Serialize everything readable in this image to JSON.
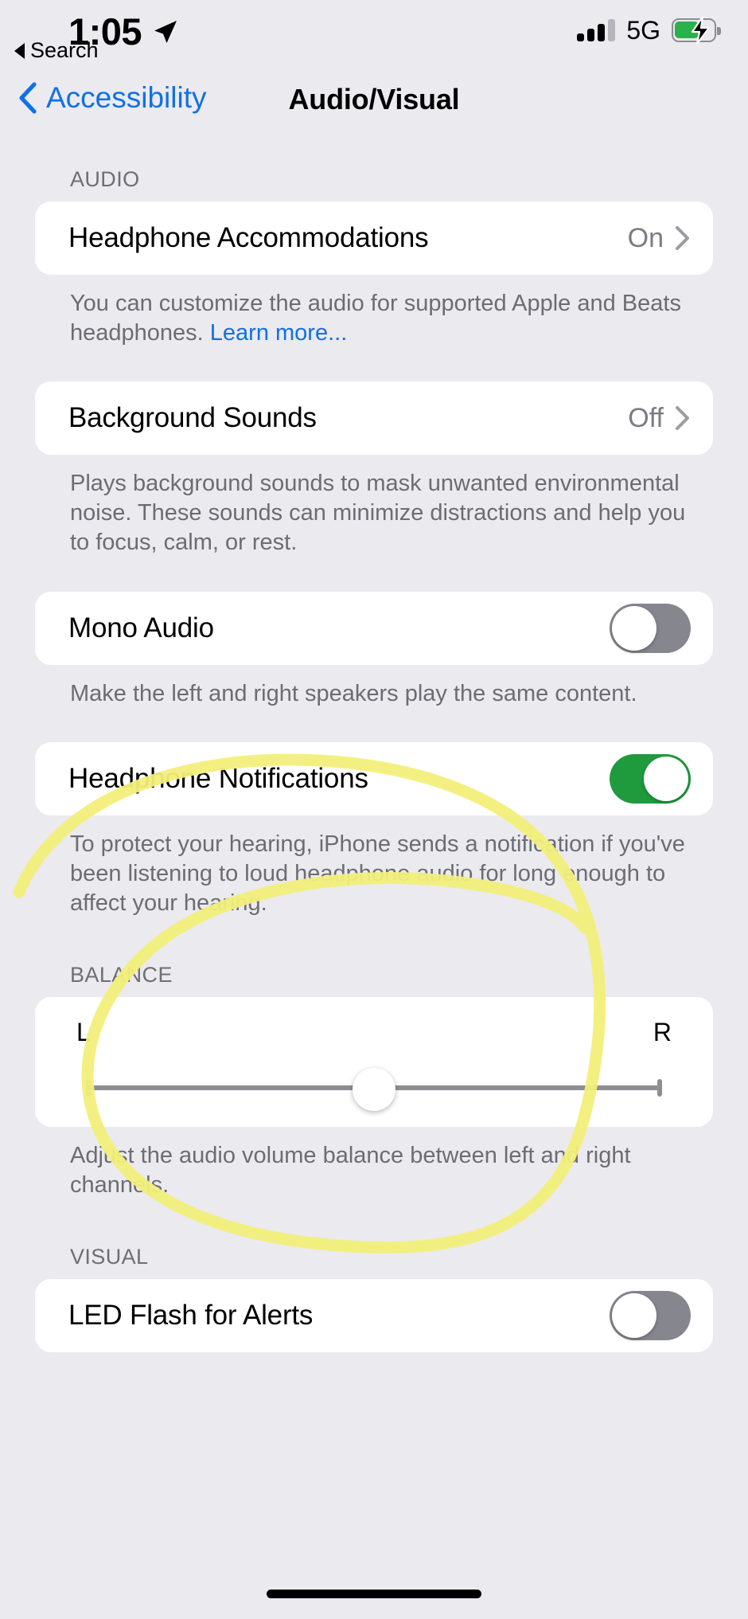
{
  "status_bar": {
    "time": "1:05",
    "location_icon": "location-arrow-icon",
    "signal_icon": "cellular-signal-icon",
    "signal_bars_filled": 3,
    "signal_bars_total": 4,
    "network": "5G",
    "battery_icon": "battery-charging-icon",
    "battery_level_pct": 55,
    "battery_charging": true,
    "battery_color": "#2bb14b",
    "back_app_label": "Search",
    "back_app_icon": "triangle-left-icon"
  },
  "nav": {
    "back_label": "Accessibility",
    "back_icon": "chevron-left-icon",
    "title": "Audio/Visual",
    "tint_color": "#1071e5"
  },
  "sections": {
    "audio_header": "AUDIO",
    "balance_header": "BALANCE",
    "visual_header": "VISUAL"
  },
  "rows": {
    "headphone_accommodations": {
      "label": "Headphone Accommodations",
      "value": "On",
      "disclosure_icon": "chevron-right-icon",
      "footnote_before_link": "You can customize the audio for supported Apple and Beats headphones. ",
      "footnote_link": "Learn more..."
    },
    "background_sounds": {
      "label": "Background Sounds",
      "value": "Off",
      "disclosure_icon": "chevron-right-icon",
      "footnote": "Plays background sounds to mask unwanted environmental noise. These sounds can minimize distractions and help you to focus, calm, or rest."
    },
    "mono_audio": {
      "label": "Mono Audio",
      "toggle_state": "off",
      "footnote": "Make the left and right speakers play the same content."
    },
    "headphone_notifications": {
      "label": "Headphone Notifications",
      "toggle_state": "on",
      "toggle_on_color": "#1f9b3e",
      "footnote": "To protect your hearing, iPhone sends a notification if you've been listening to loud headphone audio for long enough to affect your hearing."
    },
    "balance": {
      "left_label": "L",
      "right_label": "R",
      "slider_value_pct": 50,
      "footnote": "Adjust the audio volume balance between left and right channels."
    },
    "led_flash": {
      "label": "LED Flash for Alerts",
      "toggle_state": "off"
    }
  },
  "annotation": {
    "type": "highlighter-circle",
    "color": "#f2ef7a",
    "description": "hand-drawn yellow circle around Headphone Notifications and Balance"
  },
  "home_indicator": "home-indicator"
}
